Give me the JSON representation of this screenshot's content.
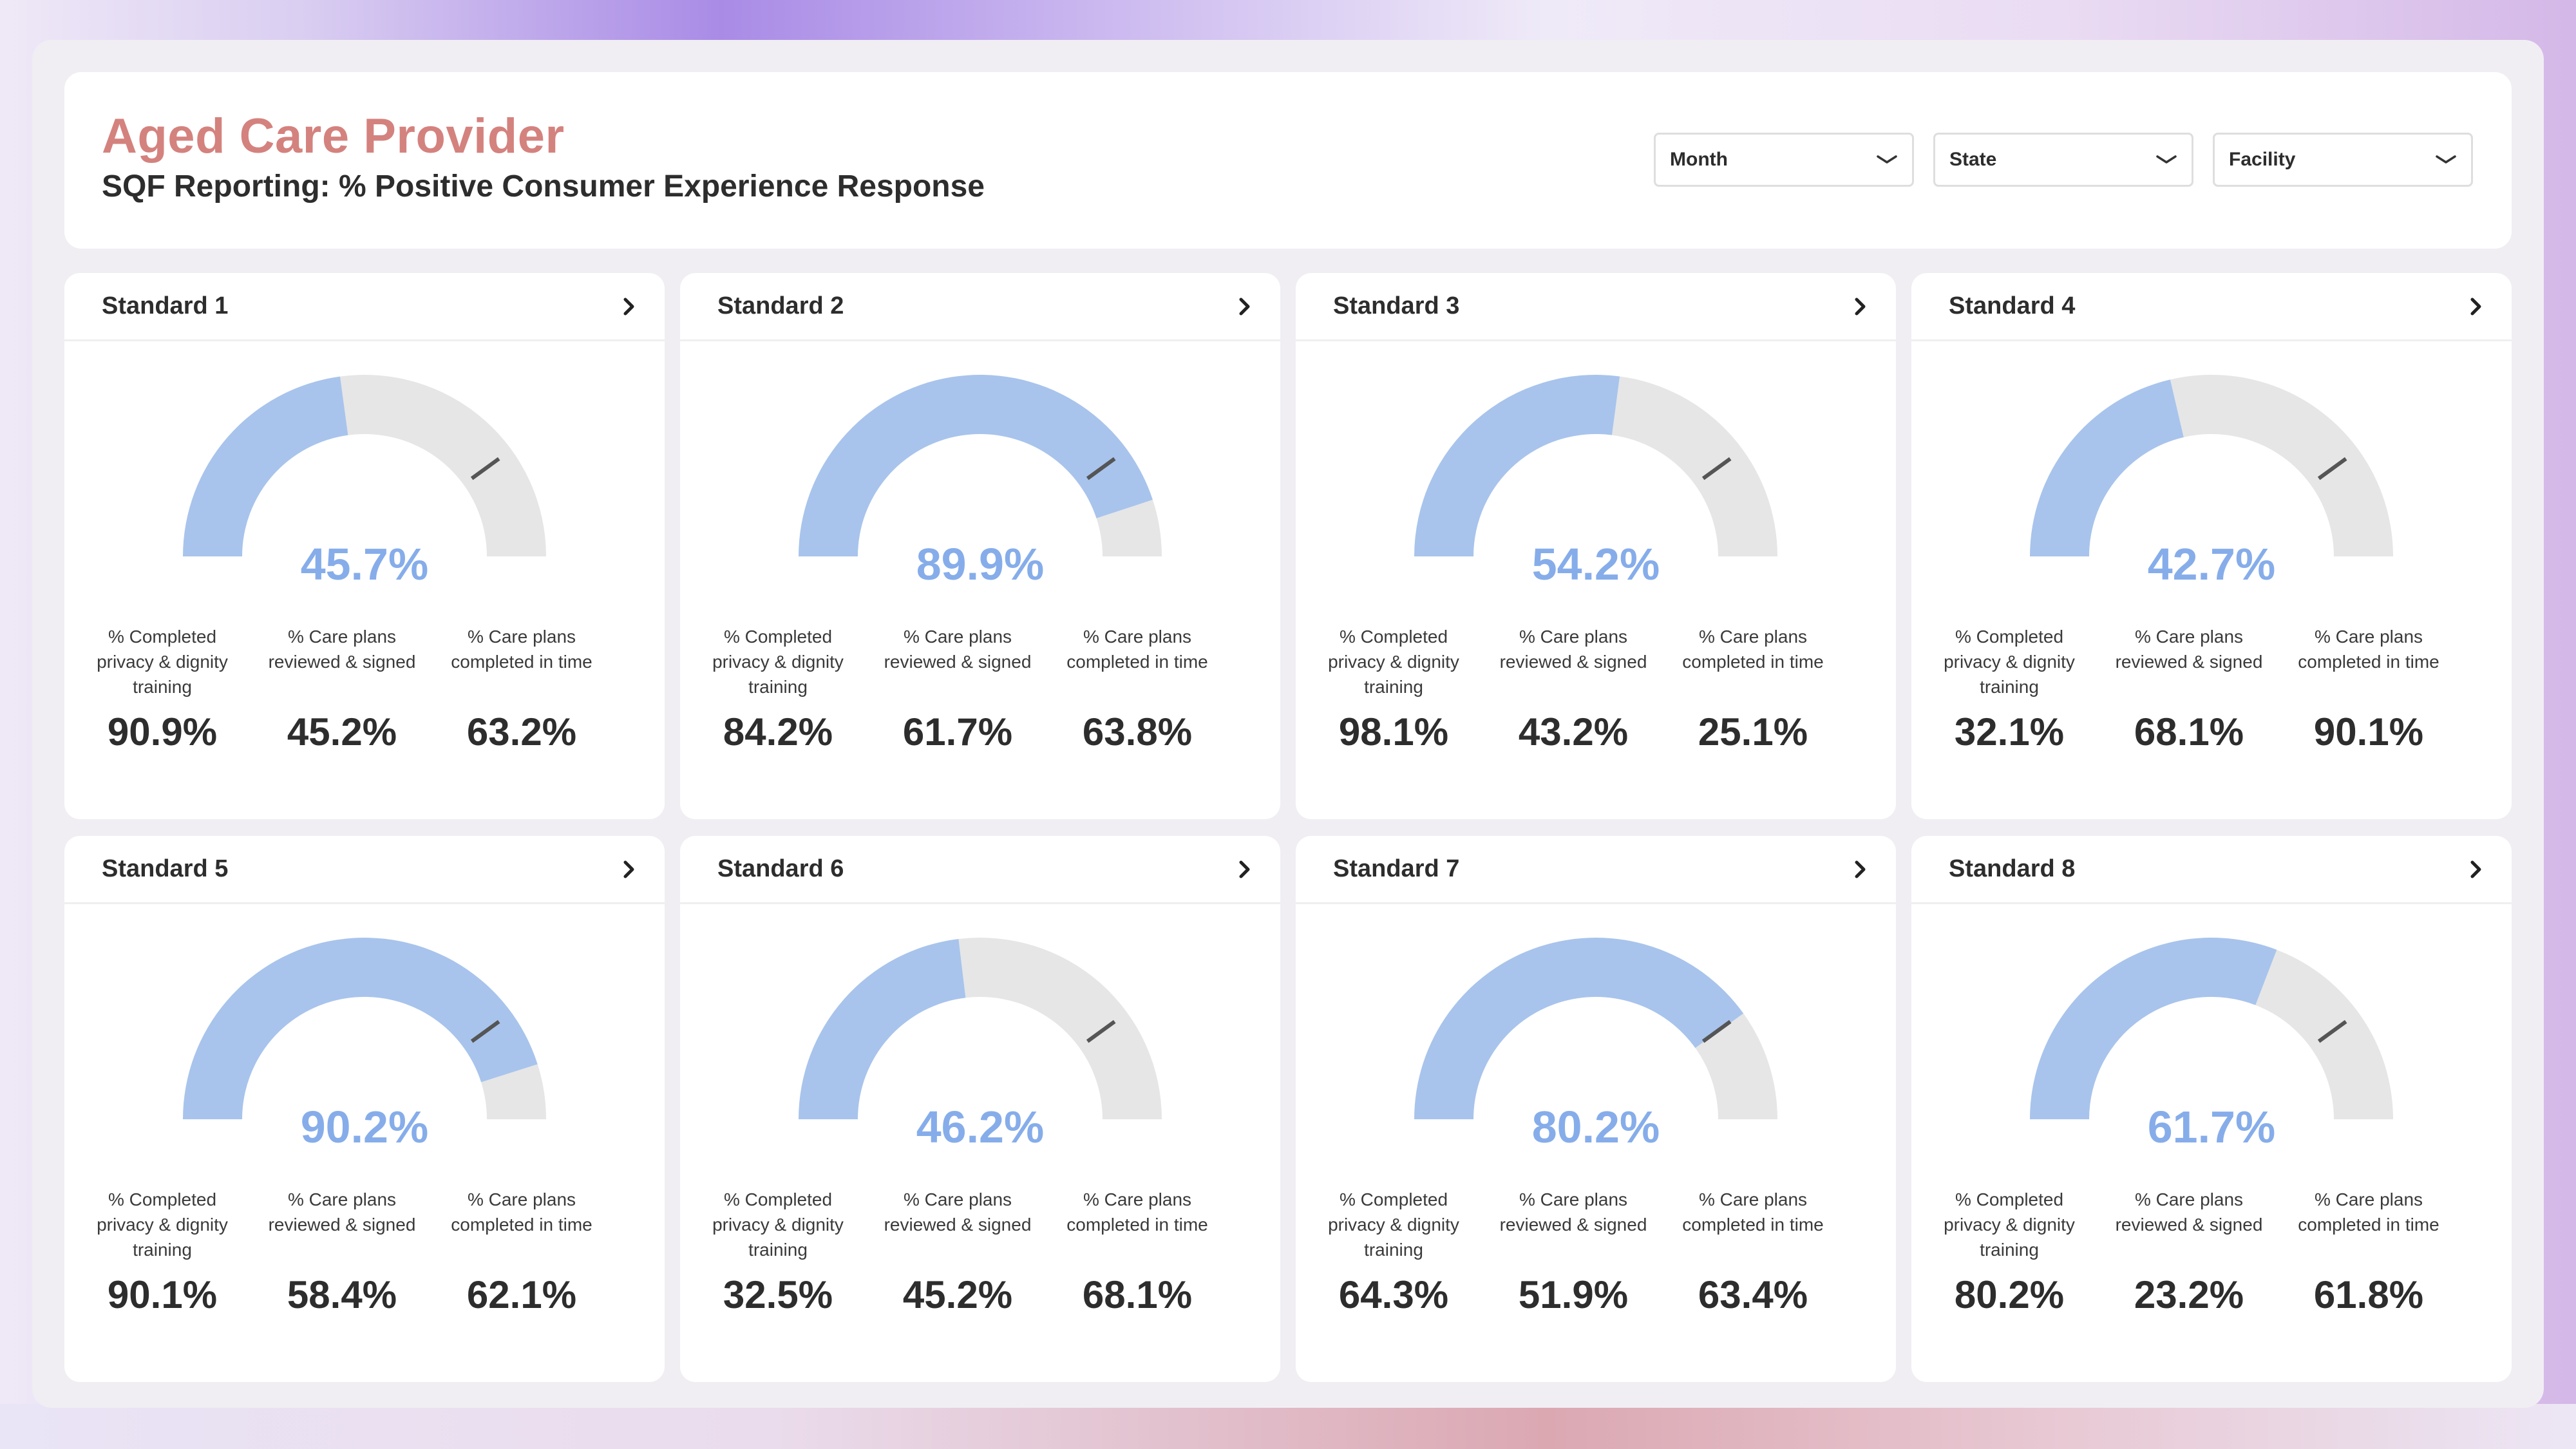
{
  "header": {
    "title": "Aged Care Provider",
    "subtitle": "SQF Reporting: % Positive Consumer Experience Response"
  },
  "filters": [
    {
      "label": "Month"
    },
    {
      "label": "State"
    },
    {
      "label": "Facility"
    }
  ],
  "metric_labels": [
    "% Completed privacy & dignity training",
    "% Care plans reviewed & signed",
    "% Care plans completed in time"
  ],
  "colors": {
    "title": "#d4827e",
    "gauge_fill": "#a8c4ec",
    "gauge_track": "#e6e6e6",
    "gauge_value": "#86adea",
    "target_marker": "#555555"
  },
  "gauge_target_percent": 80,
  "standards": [
    {
      "title": "Standard 1",
      "gauge_percent": 45.7,
      "gauge_label": "45.7%",
      "metrics": [
        "90.9%",
        "45.2%",
        "63.2%"
      ]
    },
    {
      "title": "Standard 2",
      "gauge_percent": 89.9,
      "gauge_label": "89.9%",
      "metrics": [
        "84.2%",
        "61.7%",
        "63.8%"
      ]
    },
    {
      "title": "Standard 3",
      "gauge_percent": 54.2,
      "gauge_label": "54.2%",
      "metrics": [
        "98.1%",
        "43.2%",
        "25.1%"
      ]
    },
    {
      "title": "Standard 4",
      "gauge_percent": 42.7,
      "gauge_label": "42.7%",
      "metrics": [
        "32.1%",
        "68.1%",
        "90.1%"
      ]
    },
    {
      "title": "Standard 5",
      "gauge_percent": 90.2,
      "gauge_label": "90.2%",
      "metrics": [
        "90.1%",
        "58.4%",
        "62.1%"
      ]
    },
    {
      "title": "Standard 6",
      "gauge_percent": 46.2,
      "gauge_label": "46.2%",
      "metrics": [
        "32.5%",
        "45.2%",
        "68.1%"
      ]
    },
    {
      "title": "Standard 7",
      "gauge_percent": 80.2,
      "gauge_label": "80.2%",
      "metrics": [
        "64.3%",
        "51.9%",
        "63.4%"
      ]
    },
    {
      "title": "Standard 8",
      "gauge_percent": 61.7,
      "gauge_label": "61.7%",
      "metrics": [
        "80.2%",
        "23.2%",
        "61.8%"
      ]
    }
  ]
}
